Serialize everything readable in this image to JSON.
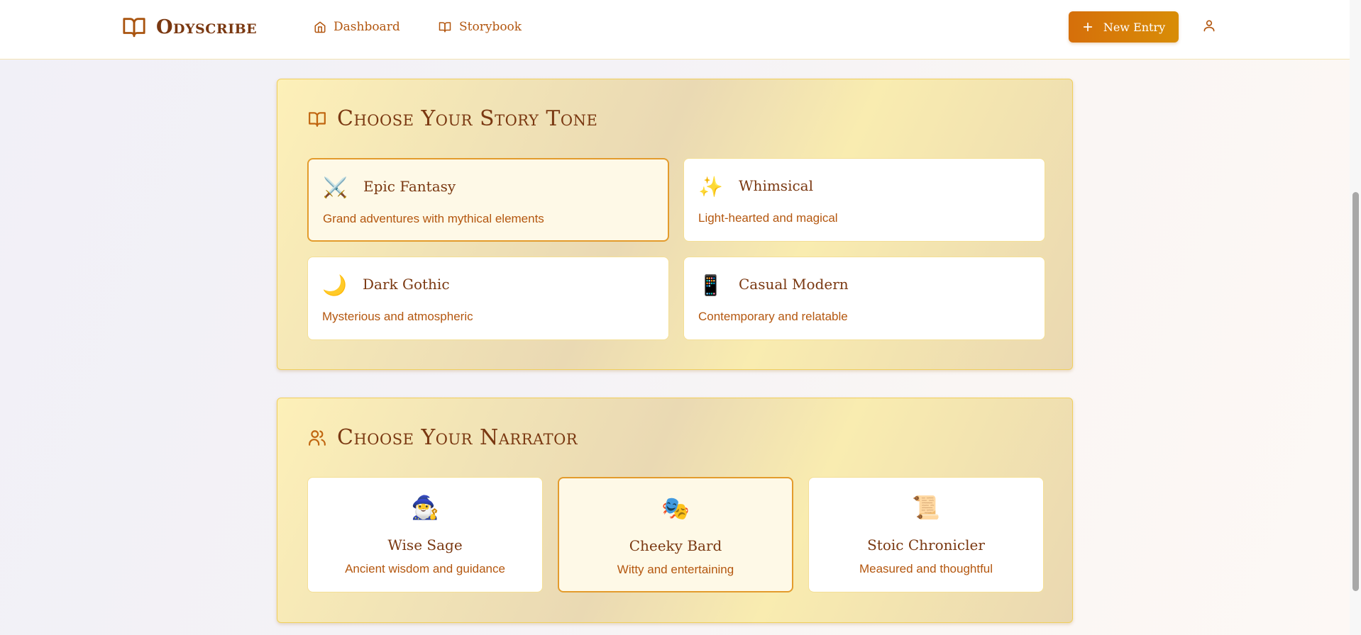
{
  "header": {
    "logo_text": "Odyscribe",
    "nav": [
      {
        "label": "Dashboard",
        "icon": "home-icon"
      },
      {
        "label": "Storybook",
        "icon": "book-icon"
      }
    ],
    "new_entry_label": "New Entry",
    "user_icon": "user-icon"
  },
  "tone_section": {
    "title": "Choose Your Story Tone",
    "icon": "book-open-icon",
    "options": [
      {
        "emoji": "⚔️",
        "name": "Epic Fantasy",
        "description": "Grand adventures with mythical elements",
        "selected": true
      },
      {
        "emoji": "✨",
        "name": "Whimsical",
        "description": "Light-hearted and magical",
        "selected": false
      },
      {
        "emoji": "🌙",
        "name": "Dark Gothic",
        "description": "Mysterious and atmospheric",
        "selected": false
      },
      {
        "emoji": "📱",
        "name": "Casual Modern",
        "description": "Contemporary and relatable",
        "selected": false
      }
    ]
  },
  "narrator_section": {
    "title": "Choose Your Narrator",
    "icon": "users-icon",
    "options": [
      {
        "emoji": "🧙‍♂️",
        "name": "Wise Sage",
        "description": "Ancient wisdom and guidance",
        "selected": false
      },
      {
        "emoji": "🎭",
        "name": "Cheeky Bard",
        "description": "Witty and entertaining",
        "selected": true
      },
      {
        "emoji": "📜",
        "name": "Stoic Chronicler",
        "description": "Measured and thoughtful",
        "selected": false
      }
    ]
  },
  "colors": {
    "accent": "#d66f0a",
    "title_brown": "#7a3811",
    "desc_orange": "#b4570f",
    "selected_border": "#e39b2c"
  }
}
